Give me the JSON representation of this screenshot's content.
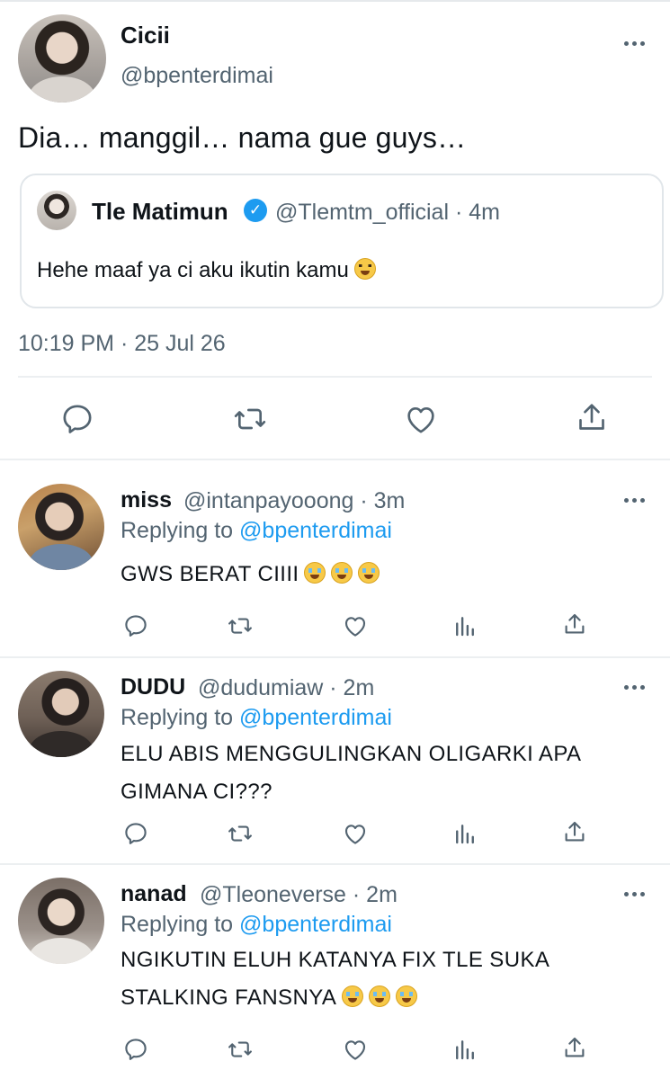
{
  "main_tweet": {
    "author_name": "Cicii",
    "author_handle": "@bpenterdimai",
    "text": "Dia… manggil… nama gue guys…",
    "quote": {
      "name": "Tle Matimun",
      "handle": "@Tlemtm_official · 4m",
      "text": "Hehe maaf ya ci aku ikutin kamu",
      "emoji": "grinning-face"
    },
    "timestamp": "10:19 PM · 25 Jul 26"
  },
  "replies": [
    {
      "name": "miss",
      "handle": "@intanpayooong · 3m",
      "replying_prefix": "Replying to ",
      "replying_to": "@bpenterdimai",
      "lines": [
        "GWS BERAT CIIII"
      ],
      "emoji": "loudly-crying-face ×3"
    },
    {
      "name": "DUDU",
      "handle": "@dudumiaw · 2m",
      "replying_prefix": "Replying to ",
      "replying_to": "@bpenterdimai",
      "lines": [
        "ELU ABIS MENGGULINGKAN OLIGARKI APA",
        "GIMANA CI???"
      ]
    },
    {
      "name": "nanad",
      "handle": "@Tleoneverse · 2m",
      "replying_prefix": "Replying to ",
      "replying_to": "@bpenterdimai",
      "lines": [
        "NGIKUTIN ELUH KATANYA FIX TLE SUKA",
        "STALKING FANSNYA"
      ],
      "emoji": "loudly-crying-face ×3"
    }
  ],
  "colors": {
    "text": "#0f1419",
    "secondary": "#536471",
    "link": "#1d9bf0",
    "divider": "#eceff1"
  }
}
